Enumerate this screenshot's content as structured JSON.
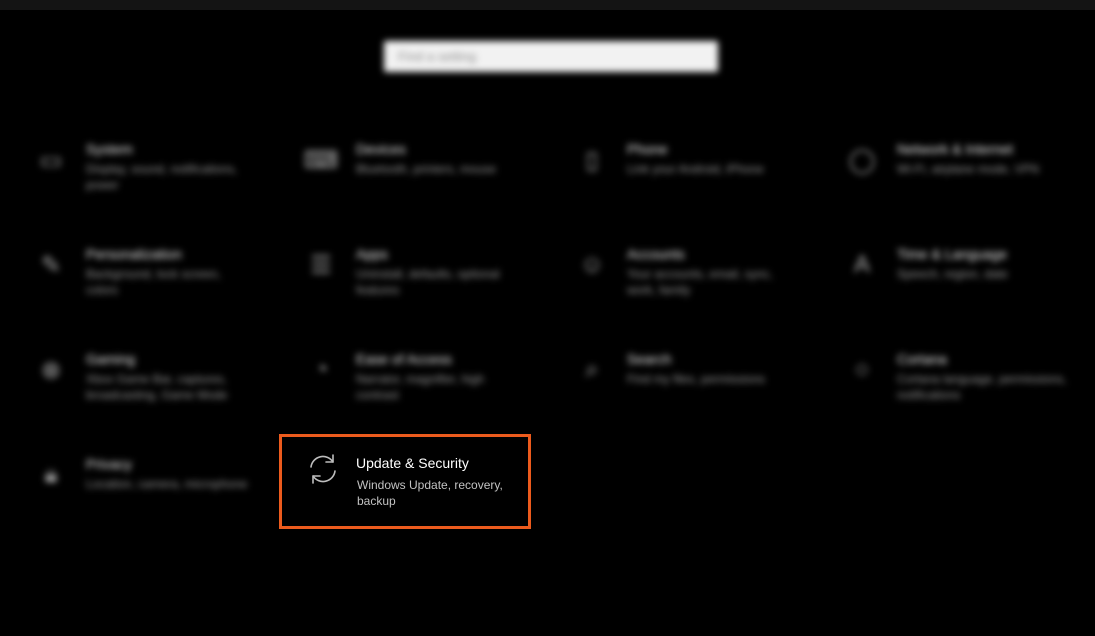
{
  "search": {
    "placeholder": "Find a setting"
  },
  "tiles": [
    {
      "title": "System",
      "desc": "Display, sound, notifications, power",
      "icon": "laptop-icon"
    },
    {
      "title": "Devices",
      "desc": "Bluetooth, printers, mouse",
      "icon": "devices-icon"
    },
    {
      "title": "Phone",
      "desc": "Link your Android, iPhone",
      "icon": "phone-icon"
    },
    {
      "title": "Network & Internet",
      "desc": "Wi-Fi, airplane mode, VPN",
      "icon": "globe-icon"
    },
    {
      "title": "Personalization",
      "desc": "Background, lock screen, colors",
      "icon": "paintbrush-icon"
    },
    {
      "title": "Apps",
      "desc": "Uninstall, defaults, optional features",
      "icon": "apps-icon"
    },
    {
      "title": "Accounts",
      "desc": "Your accounts, email, sync, work, family",
      "icon": "person-icon"
    },
    {
      "title": "Time & Language",
      "desc": "Speech, region, date",
      "icon": "time-language-icon"
    },
    {
      "title": "Gaming",
      "desc": "Xbox Game Bar, captures, broadcasting, Game Mode",
      "icon": "xbox-icon"
    },
    {
      "title": "Ease of Access",
      "desc": "Narrator, magnifier, high contrast",
      "icon": "ease-of-access-icon"
    },
    {
      "title": "Search",
      "desc": "Find my files, permissions",
      "icon": "magnifier-icon"
    },
    {
      "title": "Cortana",
      "desc": "Cortana language, permissions, notifications",
      "icon": "cortana-icon"
    },
    {
      "title": "Privacy",
      "desc": "Location, camera, microphone",
      "icon": "lock-icon"
    }
  ],
  "highlighted_tile": {
    "title": "Update & Security",
    "desc": "Windows Update, recovery, backup",
    "icon": "sync-arrows-icon",
    "highlight_color": "#ec5b1d"
  }
}
